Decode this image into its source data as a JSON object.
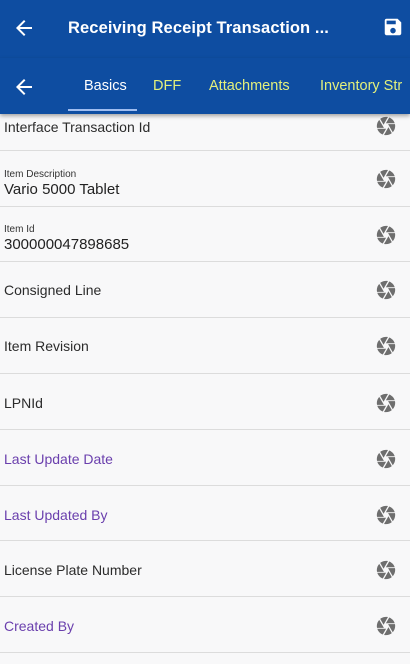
{
  "header": {
    "title": "Receiving Receipt Transaction ..."
  },
  "tabs": [
    {
      "label": "Basics"
    },
    {
      "label": "DFF"
    },
    {
      "label": "Attachments"
    },
    {
      "label": "Inventory Str"
    }
  ],
  "rows": [
    {
      "label": "Interface Transaction Id"
    },
    {
      "label": "Item Description",
      "value": "Vario 5000 Tablet"
    },
    {
      "label": "Item Id",
      "value": "300000047898685"
    },
    {
      "label": "Consigned Line"
    },
    {
      "label": "Item Revision"
    },
    {
      "label": "LPNId"
    },
    {
      "label": "Last Update Date"
    },
    {
      "label": "Last Updated By"
    },
    {
      "label": "License Plate Number"
    },
    {
      "label": "Created By"
    }
  ],
  "colors": {
    "app_bar": "#0e4da1",
    "active_tab": "#ffffff",
    "inactive_tab": "#e3f07c",
    "purple_label": "#6a3fad"
  },
  "icons": {
    "back": "arrow-left-icon",
    "save": "save-icon",
    "row_action": "aperture-icon"
  }
}
